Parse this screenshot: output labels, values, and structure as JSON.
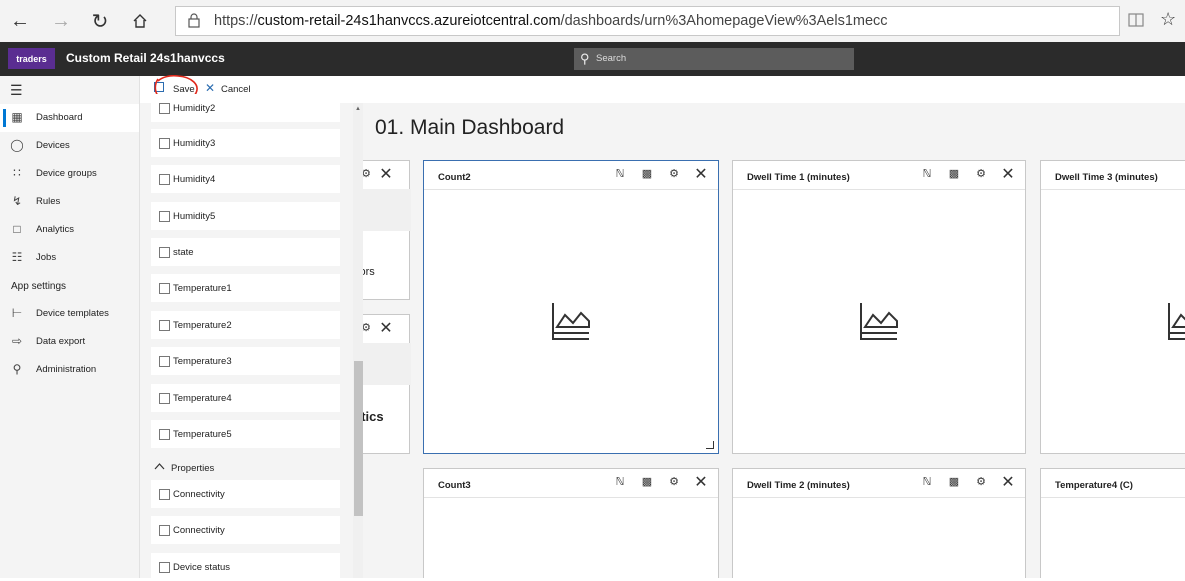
{
  "browser": {
    "url_prefix": "https://",
    "url_host": "custom-retail-24s1hanvccs.azureiotcentral.com",
    "url_path": "/dashboards/urn%3AhomepageView%3Aels1mecc"
  },
  "header": {
    "logo_text": "traders",
    "app_title": "Custom Retail 24s1hanvccs",
    "search_label": "Search"
  },
  "nav": {
    "items": [
      {
        "label": "Dashboard",
        "icon": "dashboard-icon"
      },
      {
        "label": "Devices",
        "icon": "devices-icon"
      },
      {
        "label": "Device groups",
        "icon": "device-groups-icon"
      },
      {
        "label": "Rules",
        "icon": "rules-icon"
      },
      {
        "label": "Analytics",
        "icon": "analytics-icon"
      },
      {
        "label": "Jobs",
        "icon": "jobs-icon"
      }
    ],
    "section_label": "App settings",
    "settings_items": [
      {
        "label": "Device templates",
        "icon": "device-templates-icon"
      },
      {
        "label": "Data export",
        "icon": "data-export-icon"
      },
      {
        "label": "Administration",
        "icon": "administration-icon"
      }
    ]
  },
  "toolbar": {
    "save_label": "Save",
    "cancel_label": "Cancel"
  },
  "fields": {
    "telemetry": [
      "Humidity2",
      "Humidity3",
      "Humidity4",
      "Humidity5",
      "state",
      "Temperature1",
      "Temperature2",
      "Temperature3",
      "Temperature4",
      "Temperature5"
    ],
    "properties_label": "Properties",
    "properties": [
      "Connectivity",
      "Connectivity",
      "Device status"
    ]
  },
  "dashboard": {
    "title": "01. Main Dashboard",
    "tiles": {
      "count2": "Count2",
      "dwell1": "Dwell Time 1 (minutes)",
      "dwell3": "Dwell Time 3 (minutes)",
      "count3": "Count3",
      "dwell2": "Dwell Time 2 (minutes)",
      "temp4": "Temperature4 (C)"
    },
    "partial_tile_1_text": "sors",
    "partial_tile_2_text": "ytics"
  },
  "colors": {
    "accent": "#0078d4",
    "header_bg": "#2b2b2b",
    "logo_bg": "#5a2d91",
    "purple_mark": "#6b2fa0",
    "annotation_red": "#e0281b"
  }
}
